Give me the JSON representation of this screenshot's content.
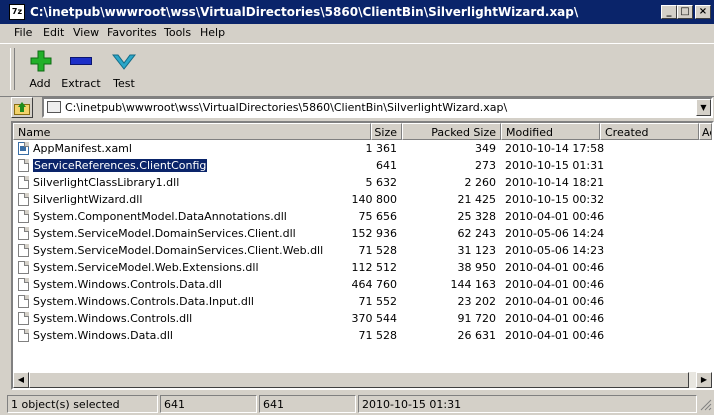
{
  "window": {
    "title": "C:\\inetpub\\wwwroot\\wss\\VirtualDirectories\\5860\\ClientBin\\SilverlightWizard.xap\\",
    "app_icon_text": "7z",
    "minimize": "_",
    "maximize": "□",
    "close": "×"
  },
  "menu": [
    "File",
    "Edit",
    "View",
    "Favorites",
    "Tools",
    "Help"
  ],
  "toolbar": {
    "add_label": "Add",
    "extract_label": "Extract",
    "test_label": "Test",
    "add_color": "#22b02a",
    "extract_color": "#1c2fc8",
    "test_color": "#2aa7c9"
  },
  "address": {
    "path": "C:\\inetpub\\wwwroot\\wss\\VirtualDirectories\\5860\\ClientBin\\SilverlightWizard.xap\\"
  },
  "columns": {
    "name": "Name",
    "size": "Size",
    "packed": "Packed Size",
    "modified": "Modified",
    "created": "Created",
    "accessed": "Ac"
  },
  "files": [
    {
      "name": "AppManifest.xaml",
      "size": "1 361",
      "packed": "349",
      "modified": "2010-10-14 17:58",
      "icon": "xml-file-icon"
    },
    {
      "name": "ServiceReferences.ClientConfig",
      "size": "641",
      "packed": "273",
      "modified": "2010-10-15 01:31",
      "icon": "file-icon",
      "selected": true
    },
    {
      "name": "SilverlightClassLibrary1.dll",
      "size": "5 632",
      "packed": "2 260",
      "modified": "2010-10-14 18:21",
      "icon": "file-icon"
    },
    {
      "name": "SilverlightWizard.dll",
      "size": "140 800",
      "packed": "21 425",
      "modified": "2010-10-15 00:32",
      "icon": "file-icon"
    },
    {
      "name": "System.ComponentModel.DataAnnotations.dll",
      "size": "75 656",
      "packed": "25 328",
      "modified": "2010-04-01 00:46",
      "icon": "file-icon"
    },
    {
      "name": "System.ServiceModel.DomainServices.Client.dll",
      "size": "152 936",
      "packed": "62 243",
      "modified": "2010-05-06 14:24",
      "icon": "file-icon"
    },
    {
      "name": "System.ServiceModel.DomainServices.Client.Web.dll",
      "size": "71 528",
      "packed": "31 123",
      "modified": "2010-05-06 14:23",
      "icon": "file-icon"
    },
    {
      "name": "System.ServiceModel.Web.Extensions.dll",
      "size": "112 512",
      "packed": "38 950",
      "modified": "2010-04-01 00:46",
      "icon": "file-icon"
    },
    {
      "name": "System.Windows.Controls.Data.dll",
      "size": "464 760",
      "packed": "144 163",
      "modified": "2010-04-01 00:46",
      "icon": "file-icon"
    },
    {
      "name": "System.Windows.Controls.Data.Input.dll",
      "size": "71 552",
      "packed": "23 202",
      "modified": "2010-04-01 00:46",
      "icon": "file-icon"
    },
    {
      "name": "System.Windows.Controls.dll",
      "size": "370 544",
      "packed": "91 720",
      "modified": "2010-04-01 00:46",
      "icon": "file-icon"
    },
    {
      "name": "System.Windows.Data.dll",
      "size": "71 528",
      "packed": "26 631",
      "modified": "2010-04-01 00:46",
      "icon": "file-icon"
    }
  ],
  "status": {
    "selected": "1 object(s) selected",
    "size": "641",
    "packed": "641",
    "modified": "2010-10-15 01:31"
  }
}
